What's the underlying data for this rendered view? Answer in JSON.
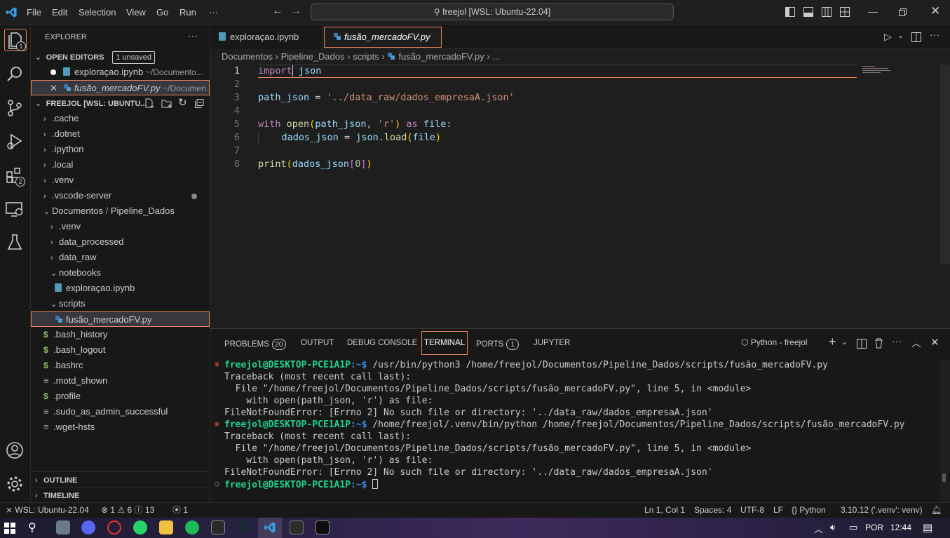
{
  "titlebar": {
    "menus": [
      "File",
      "Edit",
      "Selection",
      "View",
      "Go",
      "Run",
      "···"
    ],
    "search_text": "freejol [WSL: Ubuntu-22.04]"
  },
  "activity": {
    "explorer_badge": "1",
    "extensions_badge": "2"
  },
  "sidebar": {
    "title": "EXPLORER",
    "more": "···",
    "open_editors_label": "OPEN EDITORS",
    "unsaved_badge": "1 unsaved",
    "open_editors": [
      {
        "name": "exploraçao.ipynb",
        "path": "~/Documento..."
      },
      {
        "name": "fusão_mercadoFV.py",
        "path": "~/Documen..."
      }
    ],
    "workspace_label": "FREEJOL [WSL: UBUNTU...",
    "tree": [
      ".cache",
      ".dotnet",
      ".ipython",
      ".local",
      ".venv",
      ".vscode-server",
      "Documentos",
      "Pipeline_Dados",
      ".venv",
      "data_processed",
      "data_raw",
      "notebooks",
      "exploraçao.ipynb",
      "scripts",
      "fusão_mercadoFV.py",
      ".bash_history",
      ".bash_logout",
      ".bashrc",
      ".motd_shown",
      ".profile",
      ".sudo_as_admin_successful",
      ".wget-hsts"
    ],
    "outline_label": "OUTLINE",
    "timeline_label": "TIMELINE"
  },
  "tabs": [
    {
      "label": "exploraçao.ipynb"
    },
    {
      "label": "fusão_mercadoFV.py"
    }
  ],
  "breadcrumb": [
    "Documentos",
    "Pipeline_Dados",
    "scripts",
    "fusão_mercadoFV.py",
    "..."
  ],
  "editor": {
    "line_numbers": [
      "1",
      "2",
      "3",
      "4",
      "5",
      "6",
      "7",
      "8"
    ]
  },
  "panel": {
    "tabs": [
      "PROBLEMS",
      "OUTPUT",
      "DEBUG CONSOLE",
      "TERMINAL",
      "PORTS",
      "JUPYTER"
    ],
    "problems_count": "20",
    "ports_count": "1",
    "terminal_name": "Python - freejol",
    "prompt_user": "freejol@DESKTOP-PCE1A1P",
    "prompt_path": ":~$",
    "cmd1": " /usr/bin/python3 /home/freejol/Documentos/Pipeline_Dados/scripts/fusão_mercadoFV.py",
    "cmd2": " /home/freejol/.venv/bin/python /home/freejol/Documentos/Pipeline_Dados/scripts/fusão_mercadoFV.py",
    "traceback": "Traceback (most recent call last):",
    "file_line": "  File \"/home/freejol/Documentos/Pipeline_Dados/scripts/fusão_mercadoFV.py\", line 5, in <module>",
    "with_line": "    with open(path_json, 'r') as file:",
    "error_line": "FileNotFoundError: [Errno 2] No such file or directory: '../data_raw/dados_empresaA.json'"
  },
  "status": {
    "remote": "WSL: Ubuntu-22.04",
    "errors": "1",
    "warnings": "6",
    "info": "13",
    "ports": "1",
    "cursor": "Ln 1, Col 1",
    "spaces": "Spaces: 4",
    "encoding": "UTF-8",
    "eol": "LF",
    "language": "Python",
    "interpreter": "3.10.12 ('.venv': venv)"
  },
  "taskbar": {
    "lang": "POR",
    "time": "12:44"
  },
  "colors": {
    "accent": "#0078d4",
    "highlight_border": "#e8845b",
    "terminal_green": "#23d18b",
    "terminal_blue": "#3b8eea"
  }
}
